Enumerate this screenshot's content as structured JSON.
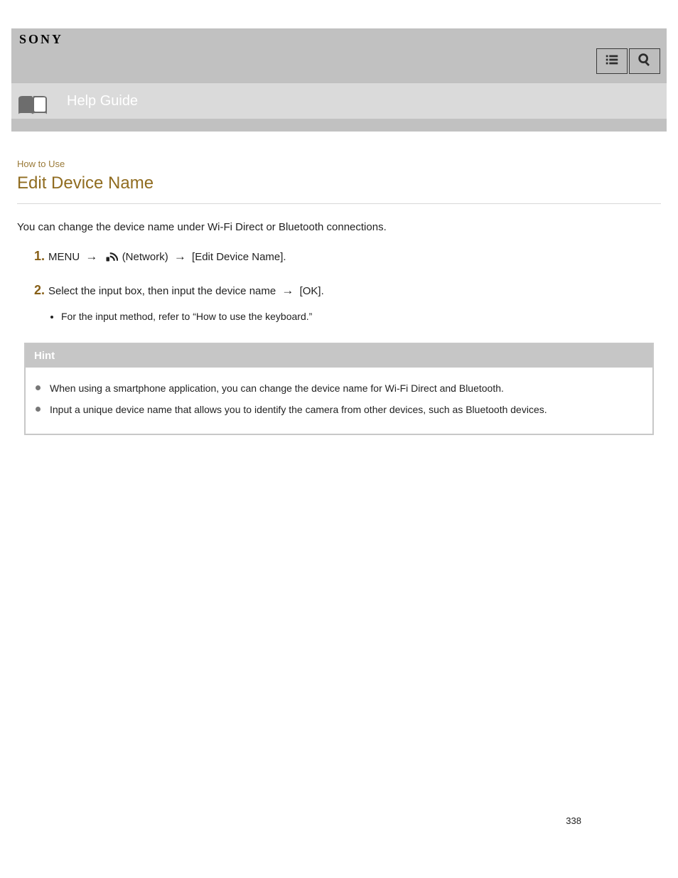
{
  "brand": "SONY",
  "header": {
    "title": "Help Guide",
    "list_button_title": "List",
    "search_button_title": "Search"
  },
  "section": {
    "label": "How to Use",
    "heading": "Edit Device Name"
  },
  "lead": "You can change the device name under Wi-Fi Direct or Bluetooth connections.",
  "steps": [
    {
      "pre": "MENU",
      "mid": "(Network)",
      "post": "[Edit Device Name]."
    },
    {
      "line_a": "Select the input box, then input the device name ",
      "line_a_tail": "[OK].",
      "sub": "For the input method, refer to “How to use the keyboard.”"
    }
  ],
  "hint": {
    "title": "Hint",
    "items": [
      "When using a smartphone application, you can change the device name for Wi-Fi Direct and Bluetooth.",
      "Input a unique device name that allows you to identify the camera from other devices, such as Bluetooth devices."
    ]
  },
  "page_number": "338"
}
